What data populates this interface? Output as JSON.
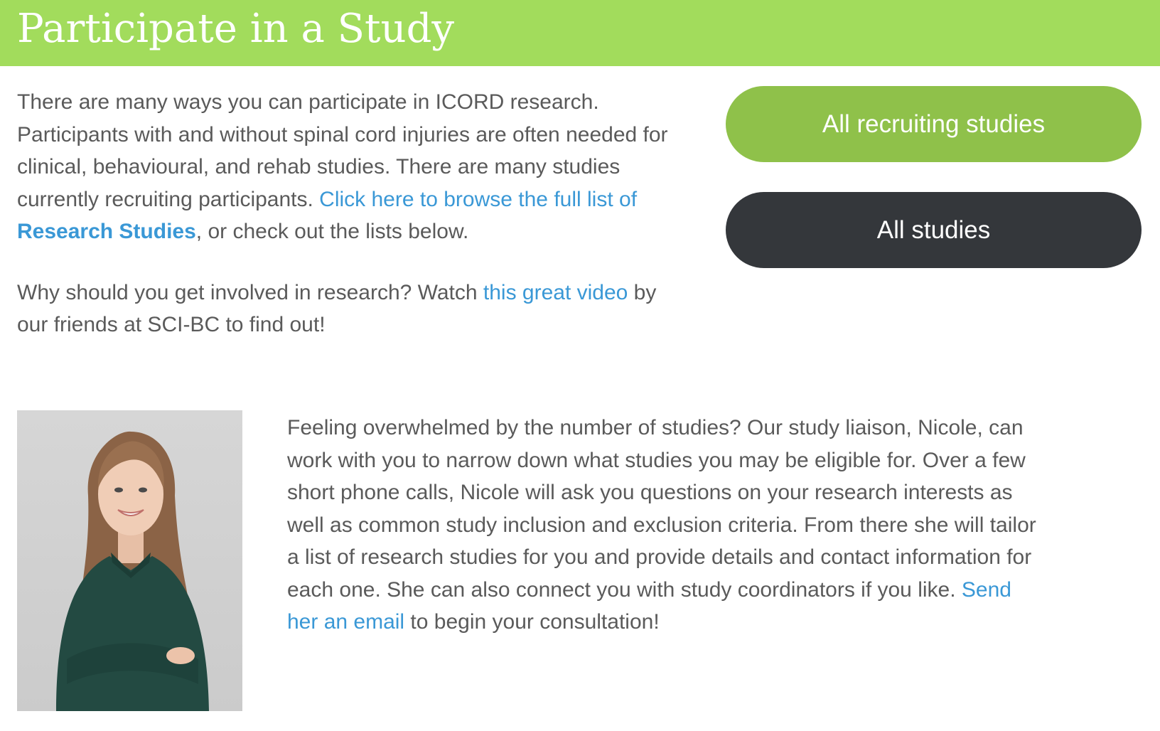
{
  "header": {
    "title": "Participate in a Study"
  },
  "intro": {
    "paragraph1": {
      "text_before_link": "There are many ways you can participate in ICORD research. Participants with and without spinal cord injuries are often needed for clinical, behavioural, and rehab studies. There are many studies currently recruiting participants. ",
      "link_text": "Click here to browse the full list of ",
      "link_bold_text": "Research Studies",
      "text_after_link": ", or check out the lists below."
    },
    "paragraph2": {
      "text_before_link": "Why should you get involved in research? Watch ",
      "link_text": "this great video",
      "text_after_link": " by our friends at SCI-BC to find out!"
    }
  },
  "buttons": {
    "recruiting_label": "All recruiting studies",
    "all_label": "All studies"
  },
  "consult": {
    "text_before_link": "Feeling overwhelmed by the number of studies? Our study liaison, Nicole, can work with you to narrow down what studies you may be eligible for. Over a few short phone calls, Nicole will ask you questions on your research interests as well as common study inclusion and exclusion criteria.  From there she will tailor a list of research studies for you and provide details and contact information for each one. She can also connect you with study coordinators if you like. ",
    "link_text": "Send her an email",
    "text_after_link": " to begin your consultation!"
  },
  "colors": {
    "banner": "#a2dc5c",
    "link": "#3a98d6",
    "recruiting_button": "#8fc14a",
    "all_button": "#34373b",
    "body_text": "#5a5a5a"
  }
}
